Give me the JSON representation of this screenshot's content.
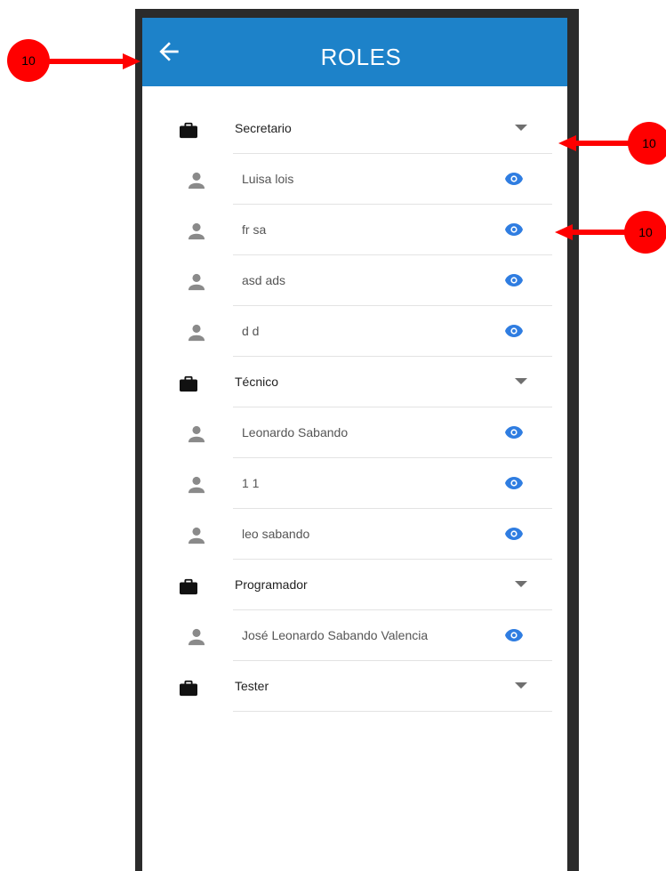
{
  "appbar": {
    "title": "ROLES",
    "back_icon": "arrow-left-icon",
    "color": "#1d82c9"
  },
  "roles": [
    {
      "name": "Secretario",
      "users": [
        "Luisa lois",
        "fr sa",
        "asd ads",
        "d d"
      ]
    },
    {
      "name": "Técnico",
      "users": [
        "Leonardo Sabando",
        "1 1",
        "leo sabando"
      ]
    },
    {
      "name": "Programador",
      "users": [
        "José Leonardo Sabando Valencia"
      ]
    },
    {
      "name": "Tester",
      "users": []
    }
  ],
  "icons": {
    "role": "briefcase-icon",
    "user": "person-icon",
    "view": "eye-icon",
    "expand": "chevron-down-icon"
  },
  "colors": {
    "eye": "#2f7de1",
    "annotation": "#ff0000"
  },
  "annotations": [
    {
      "label": "10"
    },
    {
      "label": "10"
    },
    {
      "label": "10"
    }
  ]
}
